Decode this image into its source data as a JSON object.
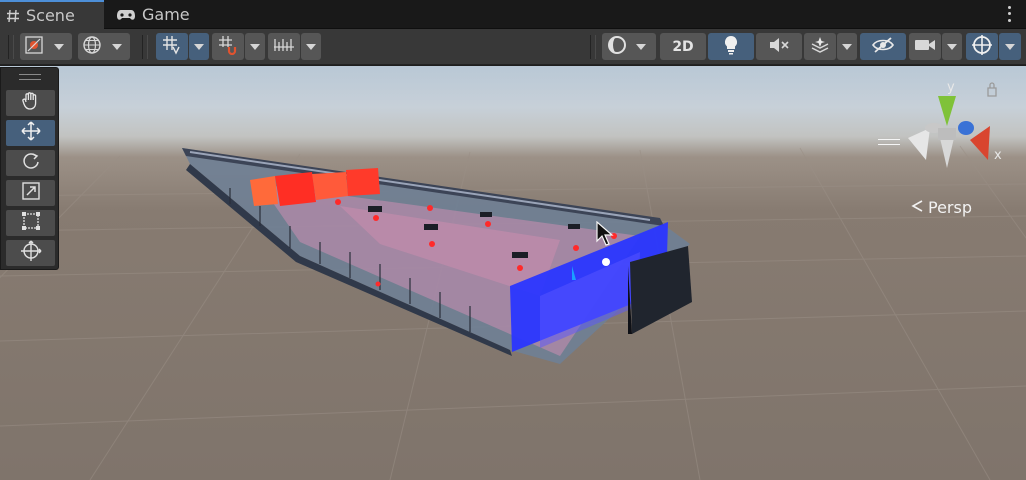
{
  "tabs": [
    {
      "label": "Scene",
      "icon": "hash-icon",
      "active": true
    },
    {
      "label": "Game",
      "icon": "gamepad-icon",
      "active": false
    }
  ],
  "toolbar": {
    "left": [
      {
        "name": "tool-settings-overlay",
        "icon": "transform-tools-icon",
        "dropdown": true
      },
      {
        "name": "global-local-toggle",
        "icon": "globe-icon",
        "dropdown": true
      },
      {
        "name": "grid-snapping",
        "icon": "grid-snap-icon",
        "dropdown": true,
        "active": true
      },
      {
        "name": "increment-snapping",
        "icon": "magnet-icon",
        "dropdown": true
      },
      {
        "name": "snap-increment",
        "icon": "ruler-icon",
        "dropdown": true
      }
    ],
    "right": [
      {
        "name": "draw-mode",
        "icon": "shaded-sphere-icon",
        "dropdown": true
      },
      {
        "name": "2d-toggle",
        "label": "2D"
      },
      {
        "name": "lighting-toggle",
        "icon": "lightbulb-icon",
        "active": true
      },
      {
        "name": "audio-toggle",
        "icon": "speaker-mute-icon"
      },
      {
        "name": "effects-toggle",
        "icon": "effects-stack-icon",
        "dropdown": true
      },
      {
        "name": "scene-visibility-toggle",
        "icon": "eye-hidden-icon",
        "active": true
      },
      {
        "name": "camera-settings",
        "icon": "camera-icon",
        "dropdown": true
      },
      {
        "name": "gizmos-toggle",
        "icon": "gizmo-sphere-icon",
        "dropdown": true,
        "active": true
      }
    ]
  },
  "tools": [
    {
      "name": "view-tool",
      "icon": "hand-icon",
      "active": false
    },
    {
      "name": "move-tool",
      "icon": "move-arrows-icon",
      "active": true
    },
    {
      "name": "rotate-tool",
      "icon": "rotate-icon",
      "active": false
    },
    {
      "name": "scale-tool",
      "icon": "scale-icon",
      "active": false
    },
    {
      "name": "rect-tool",
      "icon": "rect-transform-icon",
      "active": false
    },
    {
      "name": "transform-tool",
      "icon": "transform-icon",
      "active": false
    }
  ],
  "gizmo": {
    "axis_y": "y",
    "axis_x": "x",
    "axis_z": "z",
    "projection": "Persp",
    "colors": {
      "x": "#d9452f",
      "y": "#7fc238",
      "z": "#3a72d6"
    }
  },
  "scene": {
    "description_colors": {
      "red_wall": "#ff3b2a",
      "blue_wall": "#2f3bff",
      "floor_tint": "#b58aa8"
    }
  }
}
